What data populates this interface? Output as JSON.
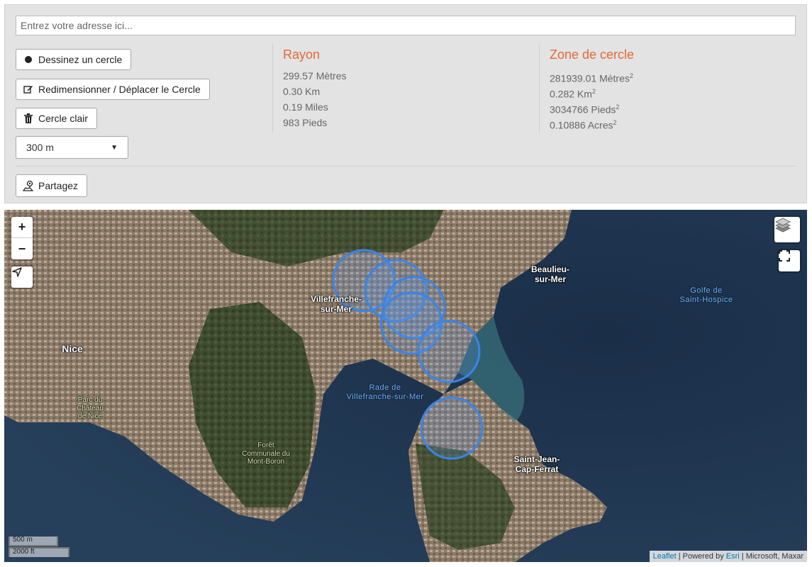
{
  "search": {
    "placeholder": "Entrez votre adresse ici..."
  },
  "toolbar": {
    "draw_label": "Dessinez un cercle",
    "resize_label": "Redimensionner / Déplacer le Cercle",
    "clear_label": "Cercle clair",
    "radius_select_value": "300 m",
    "share_label": "Partagez"
  },
  "radius": {
    "title": "Rayon",
    "meters": "299.57 Mètres",
    "km": "0.30 Km",
    "miles": "0.19 Miles",
    "feet": "983 Pieds"
  },
  "area": {
    "title": "Zone de cercle",
    "meters_value": "281939.01 Mètres",
    "km_value": "0.282 Km",
    "feet_value": "3034766 Pieds",
    "acres_value": "0.10886 Acres",
    "exponent": "2"
  },
  "map": {
    "zoom_in": "+",
    "zoom_out": "−",
    "labels": {
      "nice": "Nice",
      "villefranche": [
        "Villefranche-",
        "sur-Mer"
      ],
      "beaulieu": [
        "Beaulieu-",
        "sur-Mer"
      ],
      "saint_jean": [
        "Saint-Jean-",
        "Cap-Ferrat"
      ],
      "golfe": [
        "Golfe de",
        "Saint-Hospice"
      ],
      "rade": [
        "Rade de",
        "Villefranche-sur-Mer"
      ],
      "parc": [
        "Parc du",
        "Château",
        "de Nice"
      ],
      "foret": [
        "Forêt",
        "Communale du",
        "Mont-Boron"
      ]
    },
    "scale": {
      "metric": "500 m",
      "imperial": "2000 ft"
    },
    "attribution": {
      "leaflet": "Leaflet",
      "sep1": " | Powered by ",
      "esri": "Esri",
      "rest": " | Microsoft, Maxar"
    }
  },
  "colors": {
    "accent": "#e4683a",
    "circle_stroke": "#3a84e8",
    "circle_fill": "rgba(90,150,230,0.25)"
  }
}
